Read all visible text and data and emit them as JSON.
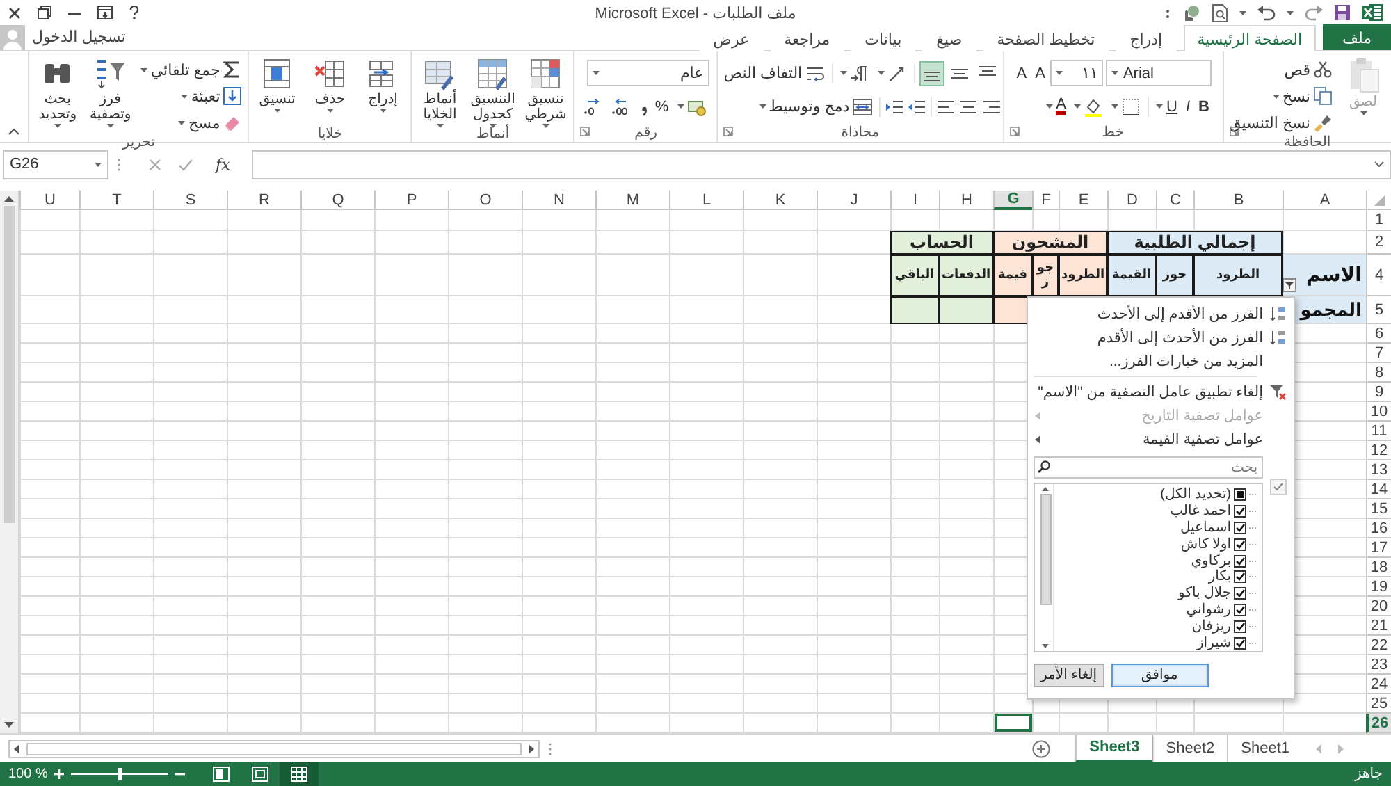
{
  "window": {
    "title": "ملف الطلبات - Microsoft Excel"
  },
  "account": {
    "label": "تسجيل الدخول"
  },
  "tabs": [
    {
      "label": "ملف",
      "kind": "file",
      "selected": false
    },
    {
      "label": "الصفحة الرئيسية",
      "kind": "tab",
      "selected": true
    },
    {
      "label": "إدراج",
      "kind": "tab",
      "selected": false
    },
    {
      "label": "تخطيط الصفحة",
      "kind": "tab",
      "selected": false
    },
    {
      "label": "صيغ",
      "kind": "tab",
      "selected": false
    },
    {
      "label": "بيانات",
      "kind": "tab",
      "selected": false
    },
    {
      "label": "مراجعة",
      "kind": "tab",
      "selected": false
    },
    {
      "label": "عرض",
      "kind": "tab",
      "selected": false
    }
  ],
  "ribbon": {
    "clipboard": {
      "label": "الحافظة",
      "paste": "لصق",
      "paste_disabled": true,
      "cut": "قص",
      "copy": "نسخ",
      "format_painter": "نسخ التنسيق"
    },
    "font": {
      "label": "خط",
      "name": "Arial",
      "size": "١١",
      "grow": "A",
      "shrink": "A",
      "bold": "B",
      "italic": "I",
      "underline": "U",
      "font_color": "A"
    },
    "alignment": {
      "label": "محاذاة",
      "vertical": [
        {
          "kind": "top",
          "selected": false
        },
        {
          "kind": "middle",
          "selected": false
        },
        {
          "kind": "bottom",
          "selected": true
        }
      ],
      "wrap_text": "التفاف النص",
      "merge_center": "دمج وتوسيط"
    },
    "number": {
      "label": "رقم",
      "format": "عام",
      "percent": "%"
    },
    "styles": {
      "label": "أنماط",
      "conditional": "تنسيق شرطي",
      "as_table": "التنسيق كجدول",
      "cell_styles": "أنماط الخلايا"
    },
    "cells": {
      "label": "خلايا",
      "insert": "إدراج",
      "delete": "حذف",
      "format": "تنسيق"
    },
    "editing": {
      "label": "تحرير",
      "autosum": "جمع تلقائي",
      "fill": "تعبئة",
      "clear": "مسح",
      "sort_filter": "فرز وتصفية",
      "find_select": "بحث وتحديد"
    }
  },
  "formula_bar": {
    "name_box": "G26",
    "function": "fx"
  },
  "sheet": {
    "columns": [
      {
        "label": "A",
        "selected": false
      },
      {
        "label": "B",
        "selected": false
      },
      {
        "label": "C",
        "selected": false
      },
      {
        "label": "D",
        "selected": false
      },
      {
        "label": "E",
        "selected": false
      },
      {
        "label": "F",
        "selected": false
      },
      {
        "label": "G",
        "selected": true
      },
      {
        "label": "H",
        "selected": false
      },
      {
        "label": "I",
        "selected": false
      },
      {
        "label": "J",
        "selected": false
      },
      {
        "label": "K",
        "selected": false
      },
      {
        "label": "L",
        "selected": false
      },
      {
        "label": "M",
        "selected": false
      },
      {
        "label": "N",
        "selected": false
      },
      {
        "label": "O",
        "selected": false
      },
      {
        "label": "P",
        "selected": false
      },
      {
        "label": "Q",
        "selected": false
      },
      {
        "label": "R",
        "selected": false
      },
      {
        "label": "S",
        "selected": false
      },
      {
        "label": "T",
        "selected": false
      },
      {
        "label": "U",
        "selected": false
      }
    ],
    "rows": [
      {
        "label": "1",
        "selected": false
      },
      {
        "label": "2",
        "selected": false
      },
      {
        "label": "4",
        "selected": false
      },
      {
        "label": "5",
        "selected": false
      },
      {
        "label": "6",
        "selected": false
      },
      {
        "label": "7",
        "selected": false
      },
      {
        "label": "8",
        "selected": false
      },
      {
        "label": "9",
        "selected": false
      },
      {
        "label": "10",
        "selected": false
      },
      {
        "label": "11",
        "selected": false
      },
      {
        "label": "12",
        "selected": false
      },
      {
        "label": "13",
        "selected": false
      },
      {
        "label": "14",
        "selected": false
      },
      {
        "label": "15",
        "selected": false
      },
      {
        "label": "16",
        "selected": false
      },
      {
        "label": "17",
        "selected": false
      },
      {
        "label": "18",
        "selected": false
      },
      {
        "label": "19",
        "selected": false
      },
      {
        "label": "20",
        "selected": false
      },
      {
        "label": "21",
        "selected": false
      },
      {
        "label": "22",
        "selected": false
      },
      {
        "label": "23",
        "selected": false
      },
      {
        "label": "24",
        "selected": false
      },
      {
        "label": "25",
        "selected": false
      },
      {
        "label": "26",
        "selected": true
      }
    ]
  },
  "table": {
    "name_header": "الاسم",
    "total_label": "المجمو",
    "groups": [
      {
        "label": "إجمالي الطلبية",
        "color": "#ddebf7",
        "headers": [
          "الطرود",
          "جوز",
          "القيمة"
        ]
      },
      {
        "label": "المشحون",
        "color": "#fce4d6",
        "headers": [
          "الطرود",
          "جوز",
          "قيمة"
        ]
      },
      {
        "label": "الحساب",
        "color": "#e2efda",
        "headers": [
          "الدفعات",
          "الباقي"
        ]
      }
    ]
  },
  "filter_menu": {
    "items": [
      {
        "label": "الفرز من الأقدم إلى الأحدث",
        "kind": "sort_asc",
        "disabled": false
      },
      {
        "label": "الفرز من الأحدث إلى الأقدم",
        "kind": "sort_desc",
        "disabled": false
      },
      {
        "label": "المزيد من خيارات الفرز...",
        "kind": "plain",
        "disabled": false
      },
      {
        "label": "إلغاء تطبيق عامل التصفية من \"الاسم\"",
        "kind": "clear_filter",
        "disabled": false
      },
      {
        "label": "عوامل تصفية التاريخ",
        "kind": "submenu",
        "disabled": true
      },
      {
        "label": "عوامل تصفية القيمة",
        "kind": "submenu",
        "disabled": false
      }
    ],
    "search": {
      "placeholder": "بحث"
    },
    "values": [
      {
        "label": "(تحديد الكل)",
        "checked": false,
        "partial": true
      },
      {
        "label": "احمد غالب",
        "checked": true,
        "partial": false
      },
      {
        "label": "اسماعيل",
        "checked": true,
        "partial": false
      },
      {
        "label": "اولا كاش",
        "checked": true,
        "partial": false
      },
      {
        "label": "بركاوي",
        "checked": true,
        "partial": false
      },
      {
        "label": "بكار",
        "checked": true,
        "partial": false
      },
      {
        "label": "جلال باكو",
        "checked": true,
        "partial": false
      },
      {
        "label": "رشواني",
        "checked": true,
        "partial": false
      },
      {
        "label": "ريزفان",
        "checked": true,
        "partial": false
      },
      {
        "label": "شيراز",
        "checked": true,
        "partial": false
      }
    ],
    "buttons": [
      {
        "label": "موافق",
        "kind": "ok"
      },
      {
        "label": "إلغاء الأمر",
        "kind": "cancel"
      }
    ]
  },
  "sheet_tabs": [
    {
      "label": "Sheet1",
      "selected": false
    },
    {
      "label": "Sheet2",
      "selected": false
    },
    {
      "label": "Sheet3",
      "selected": true
    }
  ],
  "status_bar": {
    "text": "جاهز",
    "zoom": "100 %",
    "zoom_slider": {
      "level": 0.5
    },
    "views": [
      {
        "kind": "normal",
        "selected": true
      },
      {
        "kind": "page_layout",
        "selected": false
      },
      {
        "kind": "page_break",
        "selected": false
      }
    ]
  }
}
